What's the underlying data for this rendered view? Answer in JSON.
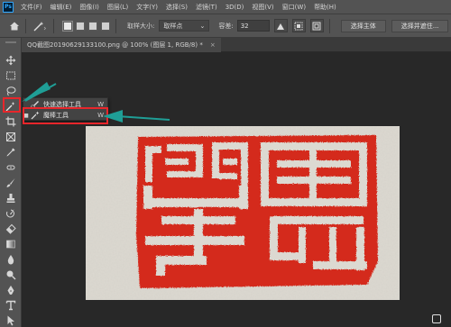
{
  "app": {
    "logo": "Ps"
  },
  "menu": {
    "items": [
      "文件(F)",
      "编辑(E)",
      "图像(I)",
      "图层(L)",
      "文字(Y)",
      "选择(S)",
      "滤镜(T)",
      "3D(D)",
      "视图(V)",
      "窗口(W)",
      "帮助(H)"
    ]
  },
  "options": {
    "sample_size_label": "取样大小:",
    "sample_size_value": "取样点",
    "tolerance_label": "容差:",
    "tolerance_value": "32",
    "select_subject_label": "选择主体",
    "select_and_mask_label": "选择并遮住..."
  },
  "document": {
    "tab_title": "QQ截图20190629133100.png @ 100% (图层 1, RGB/8) *",
    "close": "×"
  },
  "flyout": {
    "items": [
      {
        "label": "快速选择工具",
        "shortcut": "W",
        "selected": false
      },
      {
        "label": "魔棒工具",
        "shortcut": "W",
        "selected": true
      }
    ]
  },
  "colors": {
    "accent": "#e8262b",
    "annotation_arrow": "#1f9e96",
    "seal_red": "#d42a1e",
    "paper": "#dcd9d1"
  },
  "icons": {
    "tools": [
      "move-icon",
      "marquee-icon",
      "lasso-icon",
      "magic-wand-icon",
      "crop-icon",
      "frame-icon",
      "eyedropper-icon",
      "healing-brush-icon",
      "brush-icon",
      "clone-stamp-icon",
      "history-brush-icon",
      "eraser-icon",
      "gradient-icon",
      "blur-icon",
      "dodge-icon",
      "pen-icon",
      "type-icon",
      "path-selection-icon"
    ]
  }
}
